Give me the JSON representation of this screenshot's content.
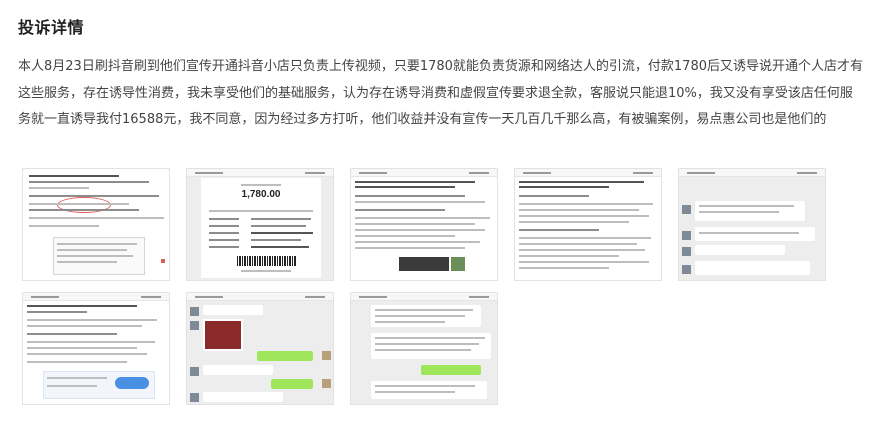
{
  "section": {
    "title": "投诉详情",
    "description": "本人8月23日刷抖音刷到他们宣传开通抖音小店只负责上传视频，只要1780就能负责货源和网络达人的引流，付款1780后又诱导说开通个人店才有这些服务，存在诱导性消费，我未享受他们的基础服务，认为存在诱导消费和虚假宣传要求退全款，客服说只能退10%，我又没有享受该店任何服务就一直诱导我付16588元，我不同意，因为经过多方打听，他们收益并没有宣传一天几百几千那么高，有被骗案例，易点惠公司也是他们的"
  },
  "attachments": [
    {
      "kind": "document-screenshot"
    },
    {
      "kind": "payment-receipt",
      "amount_text": "1,780.00"
    },
    {
      "kind": "document-screenshot"
    },
    {
      "kind": "document-screenshot"
    },
    {
      "kind": "chat-screenshot"
    },
    {
      "kind": "document-screenshot"
    },
    {
      "kind": "chat-screenshot"
    },
    {
      "kind": "chat-screenshot"
    }
  ],
  "colors": {
    "title": "#222222",
    "text": "#444444",
    "thumb_bg": "#ededed",
    "chat_bubble_green": "#9fe65c"
  }
}
